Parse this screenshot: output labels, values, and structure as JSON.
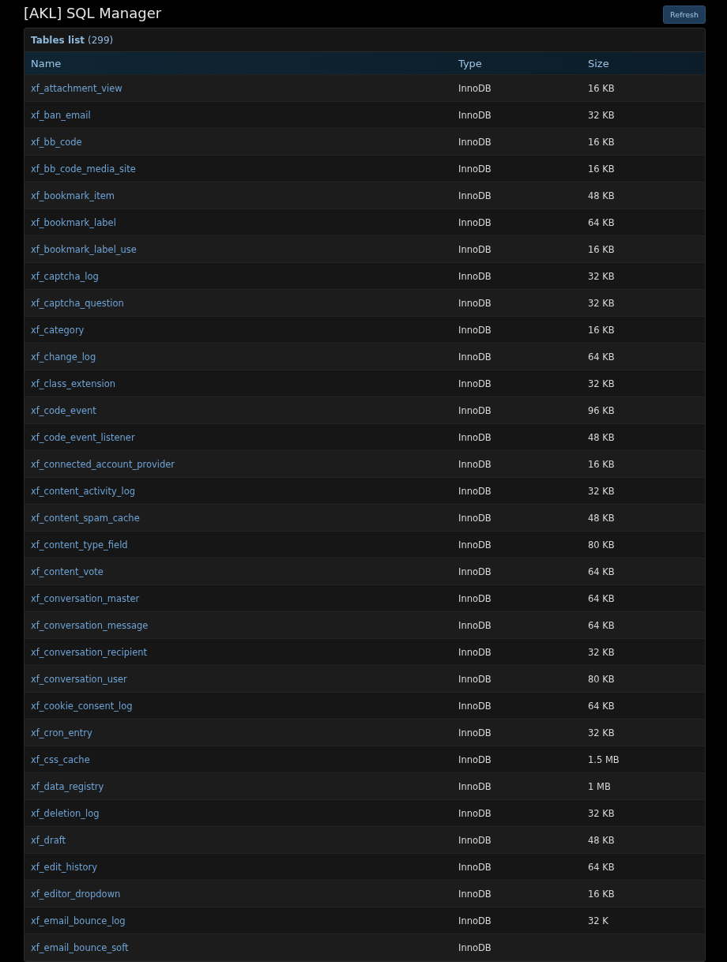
{
  "page": {
    "title": "[AKL] SQL Manager",
    "refresh_button": "Refresh"
  },
  "panel": {
    "title": "Tables list",
    "count": "(299)"
  },
  "table": {
    "columns": [
      "Name",
      "Type",
      "Size"
    ],
    "rows": [
      {
        "name": "xf_attachment_view",
        "type": "InnoDB",
        "size": "16 KB"
      },
      {
        "name": "xf_ban_email",
        "type": "InnoDB",
        "size": "32 KB"
      },
      {
        "name": "xf_bb_code",
        "type": "InnoDB",
        "size": "16 KB"
      },
      {
        "name": "xf_bb_code_media_site",
        "type": "InnoDB",
        "size": "16 KB"
      },
      {
        "name": "xf_bookmark_item",
        "type": "InnoDB",
        "size": "48 KB"
      },
      {
        "name": "xf_bookmark_label",
        "type": "InnoDB",
        "size": "64 KB"
      },
      {
        "name": "xf_bookmark_label_use",
        "type": "InnoDB",
        "size": "16 KB"
      },
      {
        "name": "xf_captcha_log",
        "type": "InnoDB",
        "size": "32 KB"
      },
      {
        "name": "xf_captcha_question",
        "type": "InnoDB",
        "size": "32 KB"
      },
      {
        "name": "xf_category",
        "type": "InnoDB",
        "size": "16 KB"
      },
      {
        "name": "xf_change_log",
        "type": "InnoDB",
        "size": "64 KB"
      },
      {
        "name": "xf_class_extension",
        "type": "InnoDB",
        "size": "32 KB"
      },
      {
        "name": "xf_code_event",
        "type": "InnoDB",
        "size": "96 KB"
      },
      {
        "name": "xf_code_event_listener",
        "type": "InnoDB",
        "size": "48 KB"
      },
      {
        "name": "xf_connected_account_provider",
        "type": "InnoDB",
        "size": "16 KB"
      },
      {
        "name": "xf_content_activity_log",
        "type": "InnoDB",
        "size": "32 KB"
      },
      {
        "name": "xf_content_spam_cache",
        "type": "InnoDB",
        "size": "48 KB"
      },
      {
        "name": "xf_content_type_field",
        "type": "InnoDB",
        "size": "80 KB"
      },
      {
        "name": "xf_content_vote",
        "type": "InnoDB",
        "size": "64 KB"
      },
      {
        "name": "xf_conversation_master",
        "type": "InnoDB",
        "size": "64 KB"
      },
      {
        "name": "xf_conversation_message",
        "type": "InnoDB",
        "size": "64 KB"
      },
      {
        "name": "xf_conversation_recipient",
        "type": "InnoDB",
        "size": "32 KB"
      },
      {
        "name": "xf_conversation_user",
        "type": "InnoDB",
        "size": "80 KB"
      },
      {
        "name": "xf_cookie_consent_log",
        "type": "InnoDB",
        "size": "64 KB"
      },
      {
        "name": "xf_cron_entry",
        "type": "InnoDB",
        "size": "32 KB"
      },
      {
        "name": "xf_css_cache",
        "type": "InnoDB",
        "size": "1.5 MB"
      },
      {
        "name": "xf_data_registry",
        "type": "InnoDB",
        "size": "1 MB"
      },
      {
        "name": "xf_deletion_log",
        "type": "InnoDB",
        "size": "32 KB"
      },
      {
        "name": "xf_draft",
        "type": "InnoDB",
        "size": "48 KB"
      },
      {
        "name": "xf_edit_history",
        "type": "InnoDB",
        "size": "64 KB"
      },
      {
        "name": "xf_editor_dropdown",
        "type": "InnoDB",
        "size": "16 KB"
      },
      {
        "name": "xf_email_bounce_log",
        "type": "InnoDB",
        "size": "32 K"
      },
      {
        "name": "xf_email_bounce_soft",
        "type": "InnoDB"
      }
    ]
  }
}
